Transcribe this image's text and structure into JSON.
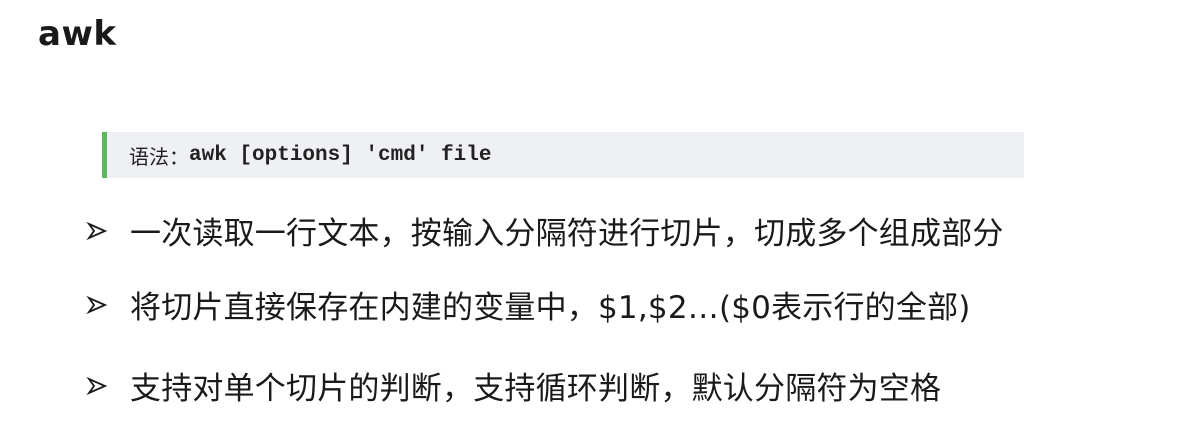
{
  "title": "awk",
  "syntax": {
    "prefix": "语法：",
    "code": "awk [options] 'cmd' file"
  },
  "bullets": [
    {
      "icon": "arrow-bullet-icon",
      "text": "一次读取一行文本，按输入分隔符进行切片，切成多个组成部分"
    },
    {
      "icon": "arrow-bullet-icon",
      "text": "将切片直接保存在内建的变量中，$1,$2…($0表示行的全部)"
    },
    {
      "icon": "arrow-bullet-icon",
      "text": "支持对单个切片的判断，支持循环判断，默认分隔符为空格"
    }
  ],
  "colors": {
    "accent_bar": "#5cb85c",
    "code_background": "#eef0f3",
    "text": "#1a1a1a"
  }
}
